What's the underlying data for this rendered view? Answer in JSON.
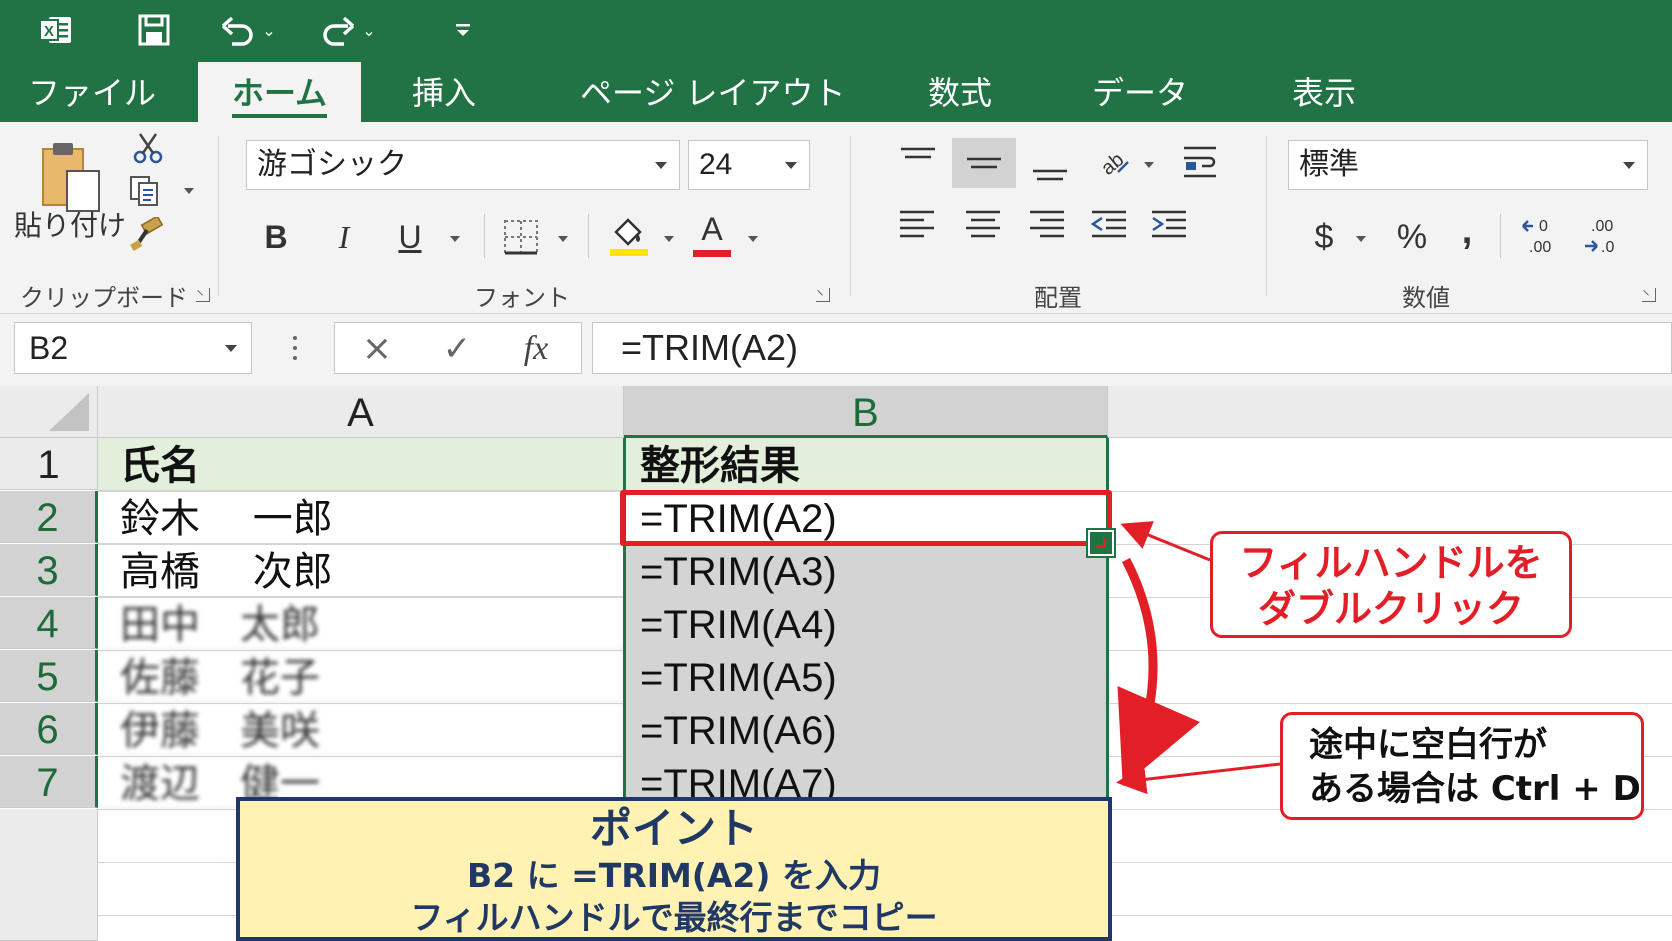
{
  "quick_access": {
    "app_icon": "excel-icon",
    "save_icon": "save-icon",
    "undo_icon": "undo-icon",
    "redo_icon": "redo-icon",
    "customize_icon": "customize-quick-access-icon"
  },
  "tabs": [
    {
      "label": "ファイル",
      "active": false
    },
    {
      "label": "ホーム",
      "active": true
    },
    {
      "label": "挿入",
      "active": false
    },
    {
      "label": "ページ レイアウト",
      "active": false
    },
    {
      "label": "数式",
      "active": false
    },
    {
      "label": "データ",
      "active": false
    },
    {
      "label": "表示",
      "active": false
    }
  ],
  "ribbon": {
    "clipboard": {
      "group_label": "クリップボード",
      "paste_label": "貼り付け"
    },
    "font": {
      "group_label": "フォント",
      "font_name": "游ゴシック",
      "font_size": "24",
      "bold": "B",
      "italic": "I",
      "underline": "U",
      "font_color_letter": "A",
      "highlight_color": "#ffe400",
      "font_color": "#e21f26"
    },
    "alignment": {
      "group_label": "配置"
    },
    "number": {
      "group_label": "数値",
      "format": "標準",
      "currency": "$",
      "percent": "%",
      "comma": ",",
      "increase_decimal": "←0\n.00",
      "decrease_decimal": ".00\n→.0"
    }
  },
  "formula_bar": {
    "name_box": "B2",
    "cancel": "×",
    "enter": "✓",
    "fx": "fx",
    "formula": "=TRIM(A2)"
  },
  "sheet": {
    "columns": [
      "A",
      "B"
    ],
    "rows": [
      "1",
      "2",
      "3",
      "4",
      "5",
      "6",
      "7"
    ],
    "col_a": [
      "氏名",
      "鈴木　 一郎",
      "高橋　 次郎",
      "田中　太郎",
      "佐藤　花子",
      "伊藤　美咲",
      "渡辺　健一"
    ],
    "col_b": [
      "整形結果",
      "=TRIM(A2)",
      "=TRIM(A3)",
      "=TRIM(A4)",
      "=TRIM(A5)",
      "=TRIM(A6)",
      "=TRIM(A7)"
    ]
  },
  "callouts": {
    "fill_handle": [
      "フィルハンドルを",
      "ダブルクリック"
    ],
    "ctrl_d": [
      "途中に空白行が",
      "ある場合は Ctrl + D"
    ],
    "point": {
      "title": "ポイント",
      "line1": "B2 に =TRIM(A2) を入力",
      "line2": "フィルハンドルで最終行までコピー"
    }
  },
  "colors": {
    "excel_green": "#217346",
    "header_row_fill": "#e2efda",
    "callout_red": "#e21f26",
    "point_fill": "#fff2b3",
    "point_border": "#1f3864"
  }
}
